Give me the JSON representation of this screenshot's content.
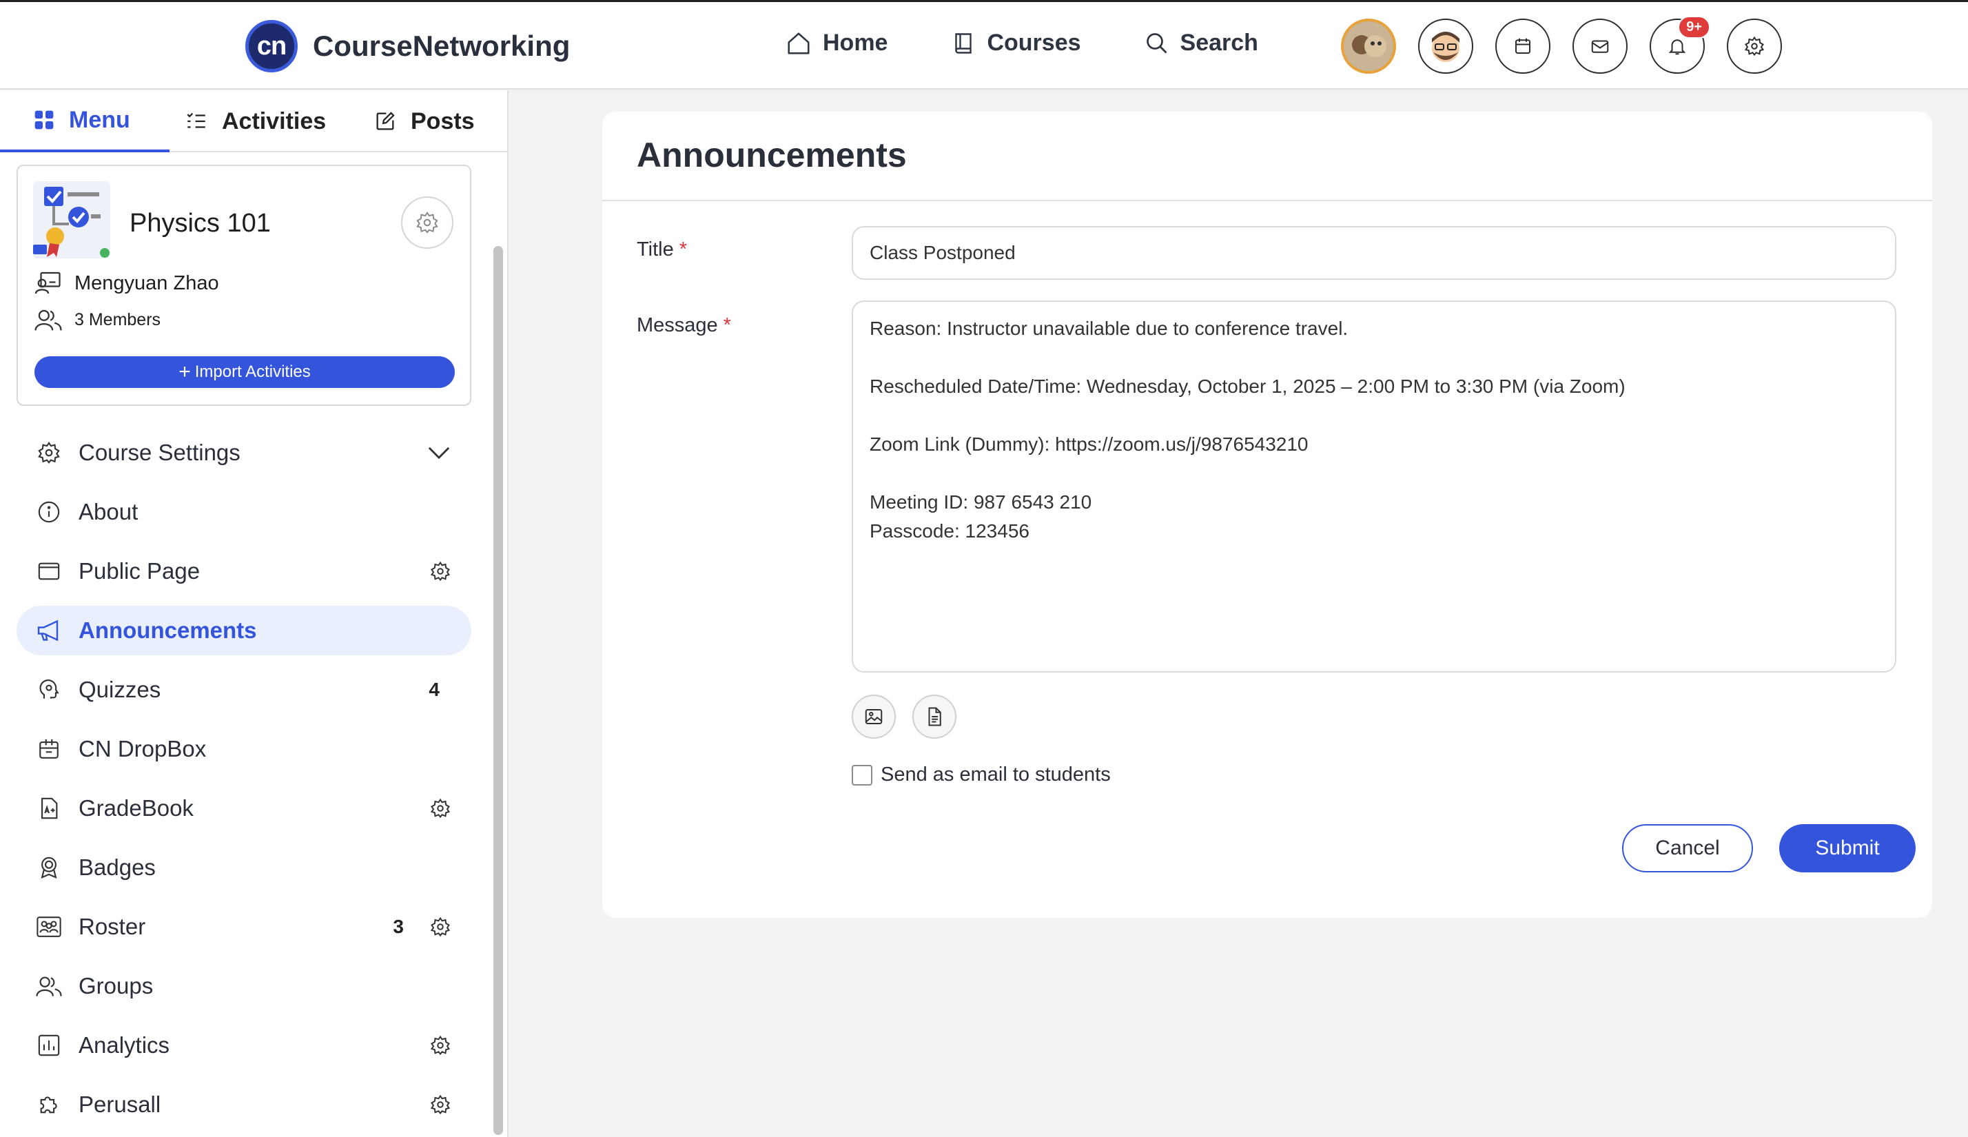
{
  "app": {
    "name": "CourseNetworking",
    "logo_text": "cn"
  },
  "topnav": {
    "home": "Home",
    "courses": "Courses",
    "search": "Search"
  },
  "top_icons": {
    "notification_badge": "9+",
    "items": [
      "avatar-photo",
      "avatar-cartoon",
      "calendar-icon",
      "mail-icon",
      "bell-icon",
      "gear-icon"
    ]
  },
  "sidebar": {
    "tabs": {
      "menu": "Menu",
      "activities": "Activities",
      "posts": "Posts"
    },
    "course": {
      "title": "Physics 101",
      "owner": "Mengyuan Zhao",
      "members": "3 Members",
      "import_label": "Import Activities"
    },
    "items": [
      {
        "label": "Course Settings",
        "icon": "gear-icon",
        "chevron": true
      },
      {
        "label": "About",
        "icon": "info-icon"
      },
      {
        "label": "Public Page",
        "icon": "browser-icon",
        "gear": true
      },
      {
        "label": "Announcements",
        "icon": "megaphone-icon",
        "active": true
      },
      {
        "label": "Quizzes",
        "icon": "head-icon",
        "count": "4"
      },
      {
        "label": "CN DropBox",
        "icon": "dropbox-icon"
      },
      {
        "label": "GradeBook",
        "icon": "gradebook-icon",
        "gear": true
      },
      {
        "label": "Badges",
        "icon": "badge-icon"
      },
      {
        "label": "Roster",
        "icon": "roster-icon",
        "count": "3",
        "gear": true
      },
      {
        "label": "Groups",
        "icon": "groups-icon"
      },
      {
        "label": "Analytics",
        "icon": "analytics-icon",
        "gear": true
      },
      {
        "label": "Perusall",
        "icon": "puzzle-icon",
        "gear": true
      }
    ]
  },
  "main": {
    "title": "Announcements",
    "title_label": "Title",
    "title_value": "Class Postponed",
    "message_label": "Message",
    "required_mark": "*",
    "message_lines": [
      "Reason: Instructor unavailable due to conference travel.",
      "",
      "Rescheduled Date/Time: Wednesday, October 1, 2025 – 2:00 PM to 3:30 PM (via Zoom)",
      "",
      "Zoom Link (Dummy): https://zoom.us/j/9876543210",
      "",
      "Meeting ID: 987 6543 210",
      "Passcode: 123456"
    ],
    "email_label": "Send as email to students",
    "cancel_label": "Cancel",
    "submit_label": "Submit"
  },
  "colors": {
    "accent": "#3455db",
    "active_bg": "#e9effd",
    "required": "#d9363e",
    "badge": "#e03b3b"
  }
}
